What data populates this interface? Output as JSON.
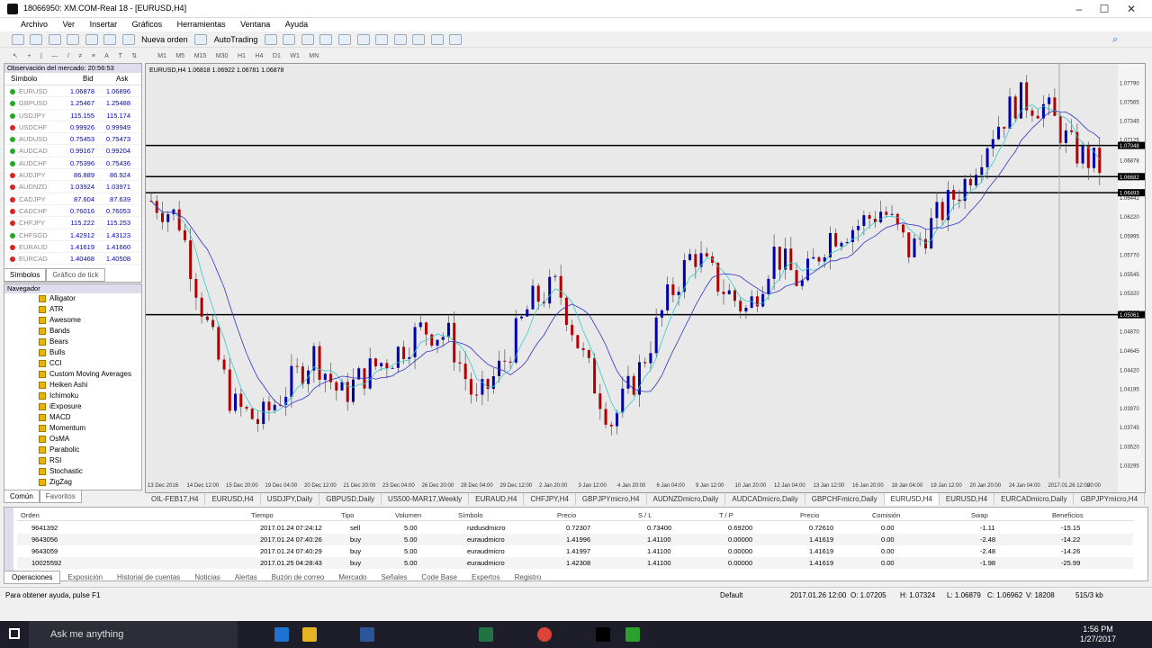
{
  "window": {
    "title": "18066950: XM.COM-Real 18 - [EURUSD,H4]"
  },
  "menu": [
    "Archivo",
    "Ver",
    "Insertar",
    "Gráficos",
    "Herramientas",
    "Ventana",
    "Ayuda"
  ],
  "toolbar": {
    "new_order": "Nueva orden",
    "autotrading": "AutoTrading"
  },
  "timeframes": [
    "M1",
    "M5",
    "M15",
    "M30",
    "H1",
    "H4",
    "D1",
    "W1",
    "MN"
  ],
  "market_watch": {
    "title": "Observación del mercado: 20:56:53",
    "col_symbol": "Símbolo",
    "col_bid": "Bid",
    "col_ask": "Ask",
    "rows": [
      {
        "symbol": "EURUSD",
        "bid": "1.06878",
        "ask": "1.06896",
        "color": "#2a2"
      },
      {
        "symbol": "GBPUSD",
        "bid": "1.25467",
        "ask": "1.25488",
        "color": "#2a2"
      },
      {
        "symbol": "USDJPY",
        "bid": "115.155",
        "ask": "115.174",
        "color": "#2a2"
      },
      {
        "symbol": "USDCHF",
        "bid": "0.99926",
        "ask": "0.99949",
        "color": "#d22"
      },
      {
        "symbol": "AUDUSD",
        "bid": "0.75453",
        "ask": "0.75473",
        "color": "#2a2"
      },
      {
        "symbol": "AUDCAD",
        "bid": "0.99167",
        "ask": "0.99204",
        "color": "#2a2"
      },
      {
        "symbol": "AUDCHF",
        "bid": "0.75396",
        "ask": "0.75436",
        "color": "#2a2"
      },
      {
        "symbol": "AUDJPY",
        "bid": "86.889",
        "ask": "86.924",
        "color": "#d22"
      },
      {
        "symbol": "AUDNZD",
        "bid": "1.03924",
        "ask": "1.03971",
        "color": "#d22"
      },
      {
        "symbol": "CADJPY",
        "bid": "87.604",
        "ask": "87.639",
        "color": "#d22"
      },
      {
        "symbol": "CADCHF",
        "bid": "0.76016",
        "ask": "0.76053",
        "color": "#d22"
      },
      {
        "symbol": "CHFJPY",
        "bid": "115.222",
        "ask": "115.253",
        "color": "#d22"
      },
      {
        "symbol": "CHFSGD",
        "bid": "1.42912",
        "ask": "1.43123",
        "color": "#2a2"
      },
      {
        "symbol": "EURAUD",
        "bid": "1.41619",
        "ask": "1.41660",
        "color": "#d22"
      },
      {
        "symbol": "EURCAD",
        "bid": "1.40468",
        "ask": "1.40508",
        "color": "#d22"
      }
    ],
    "tabs": [
      "Símbolos",
      "Gráfico de tick"
    ]
  },
  "navigator": {
    "title": "Navegador",
    "items": [
      "Alligator",
      "ATR",
      "Awesome",
      "Bands",
      "Bears",
      "Bulls",
      "CCI",
      "Custom Moving Averages",
      "Heiken Ashi",
      "Ichimoku",
      "iExposure",
      "MACD",
      "Momentum",
      "OsMA",
      "Parabolic",
      "RSI",
      "Stochastic",
      "ZigZag"
    ],
    "tabs": [
      "Común",
      "Favoritos"
    ]
  },
  "chart": {
    "info": "EURUSD,H4  1.06818 1.06922 1.06781 1.06878",
    "price_labels": [
      "1.07790",
      "1.07565",
      "1.07345",
      "1.07125",
      "1.06878",
      "1.06670",
      "1.06442",
      "1.06220",
      "1.05995",
      "1.05770",
      "1.05545",
      "1.05320",
      "1.05095",
      "1.04870",
      "1.04645",
      "1.04420",
      "1.04195",
      "1.03970",
      "1.03745",
      "1.03520",
      "1.03295"
    ],
    "date_labels": [
      "13 Dec 2016",
      "14 Dec 12:00",
      "15 Dec 20:00",
      "19 Dec 04:00",
      "20 Dec 12:00",
      "21 Dec 20:00",
      "23 Dec 04:00",
      "26 Dec 20:00",
      "28 Dec 04:00",
      "29 Dec 12:00",
      "2 Jan 20:00",
      "3 Jan 12:00",
      "4 Jan 20:00",
      "6 Jan 04:00",
      "9 Jan 12:00",
      "10 Jan 20:00",
      "12 Jan 04:00",
      "13 Jan 12:00",
      "16 Jan 20:00",
      "18 Jan 04:00",
      "19 Jan 12:00",
      "20 Jan 20:00",
      "24 Jan 04:00",
      "2017.01.26 12:00",
      "20:00"
    ],
    "line_labels": [
      "1.07048",
      "1.06682",
      "1.06493",
      "1.05061"
    ]
  },
  "chart_tabs": [
    "OIL-FEB17,H4",
    "EURUSD,H4",
    "USDJPY,Daily",
    "GBPUSD,Daily",
    "US500-MAR17,Weekly",
    "EURAUD,H4",
    "CHFJPY,H4",
    "GBPJPYmicro,H4",
    "AUDNZDmicro,Daily",
    "AUDCADmicro,Daily",
    "GBPCHFmicro,Daily",
    "EURUSD,H4",
    "EURUSD,H4",
    "EURCADmicro,Daily",
    "GBPJPYmicro,H4",
    "AUDUSD"
  ],
  "terminal": {
    "cols": [
      "Orden",
      "Tiempo",
      "Tipo",
      "Volumen",
      "Símbolo",
      "Precio",
      "S / L",
      "T / P",
      "Precio",
      "Comisión",
      "Swap",
      "Beneficios"
    ],
    "rows": [
      [
        "9641392",
        "2017.01.24 07:24:12",
        "sell",
        "5.00",
        "nzdusdmicro",
        "0.72307",
        "0.73400",
        "0.69200",
        "0.72610",
        "0.00",
        "-1.11",
        "-15.15"
      ],
      [
        "9643056",
        "2017.01.24 07:40:26",
        "buy",
        "5.00",
        "euraudmicro",
        "1.41996",
        "1.41100",
        "0.00000",
        "1.41619",
        "0.00",
        "-2.48",
        "-14.22"
      ],
      [
        "9643059",
        "2017.01.24 07:40:29",
        "buy",
        "5.00",
        "euraudmicro",
        "1.41997",
        "1.41100",
        "0.00000",
        "1.41619",
        "0.00",
        "-2.48",
        "-14.26"
      ],
      [
        "10025592",
        "2017.01.25 04:28:43",
        "buy",
        "5.00",
        "euraudmicro",
        "1.42308",
        "1.41100",
        "0.00000",
        "1.41619",
        "0.00",
        "-1.98",
        "-25.99"
      ]
    ],
    "tabs": [
      "Operaciones",
      "Exposición",
      "Historial de cuentas",
      "Noticias",
      "Alertas",
      "Buzón de correo",
      "Mercado",
      "Señales",
      "Code Base",
      "Expertos",
      "Registro"
    ],
    "side_label": "Terminal"
  },
  "status": {
    "help": "Para obtener ayuda, pulse F1",
    "profile": "Default",
    "time": "2017.01.26 12:00",
    "open": "O: 1.07205",
    "high": "H: 1.07324",
    "low": "L: 1.06879",
    "close": "C: 1.06962",
    "volume": "V: 18208",
    "net": "515/3 kb"
  },
  "taskbar": {
    "search": "Ask me anything",
    "time": "1:56 PM",
    "date": "1/27/2017"
  }
}
